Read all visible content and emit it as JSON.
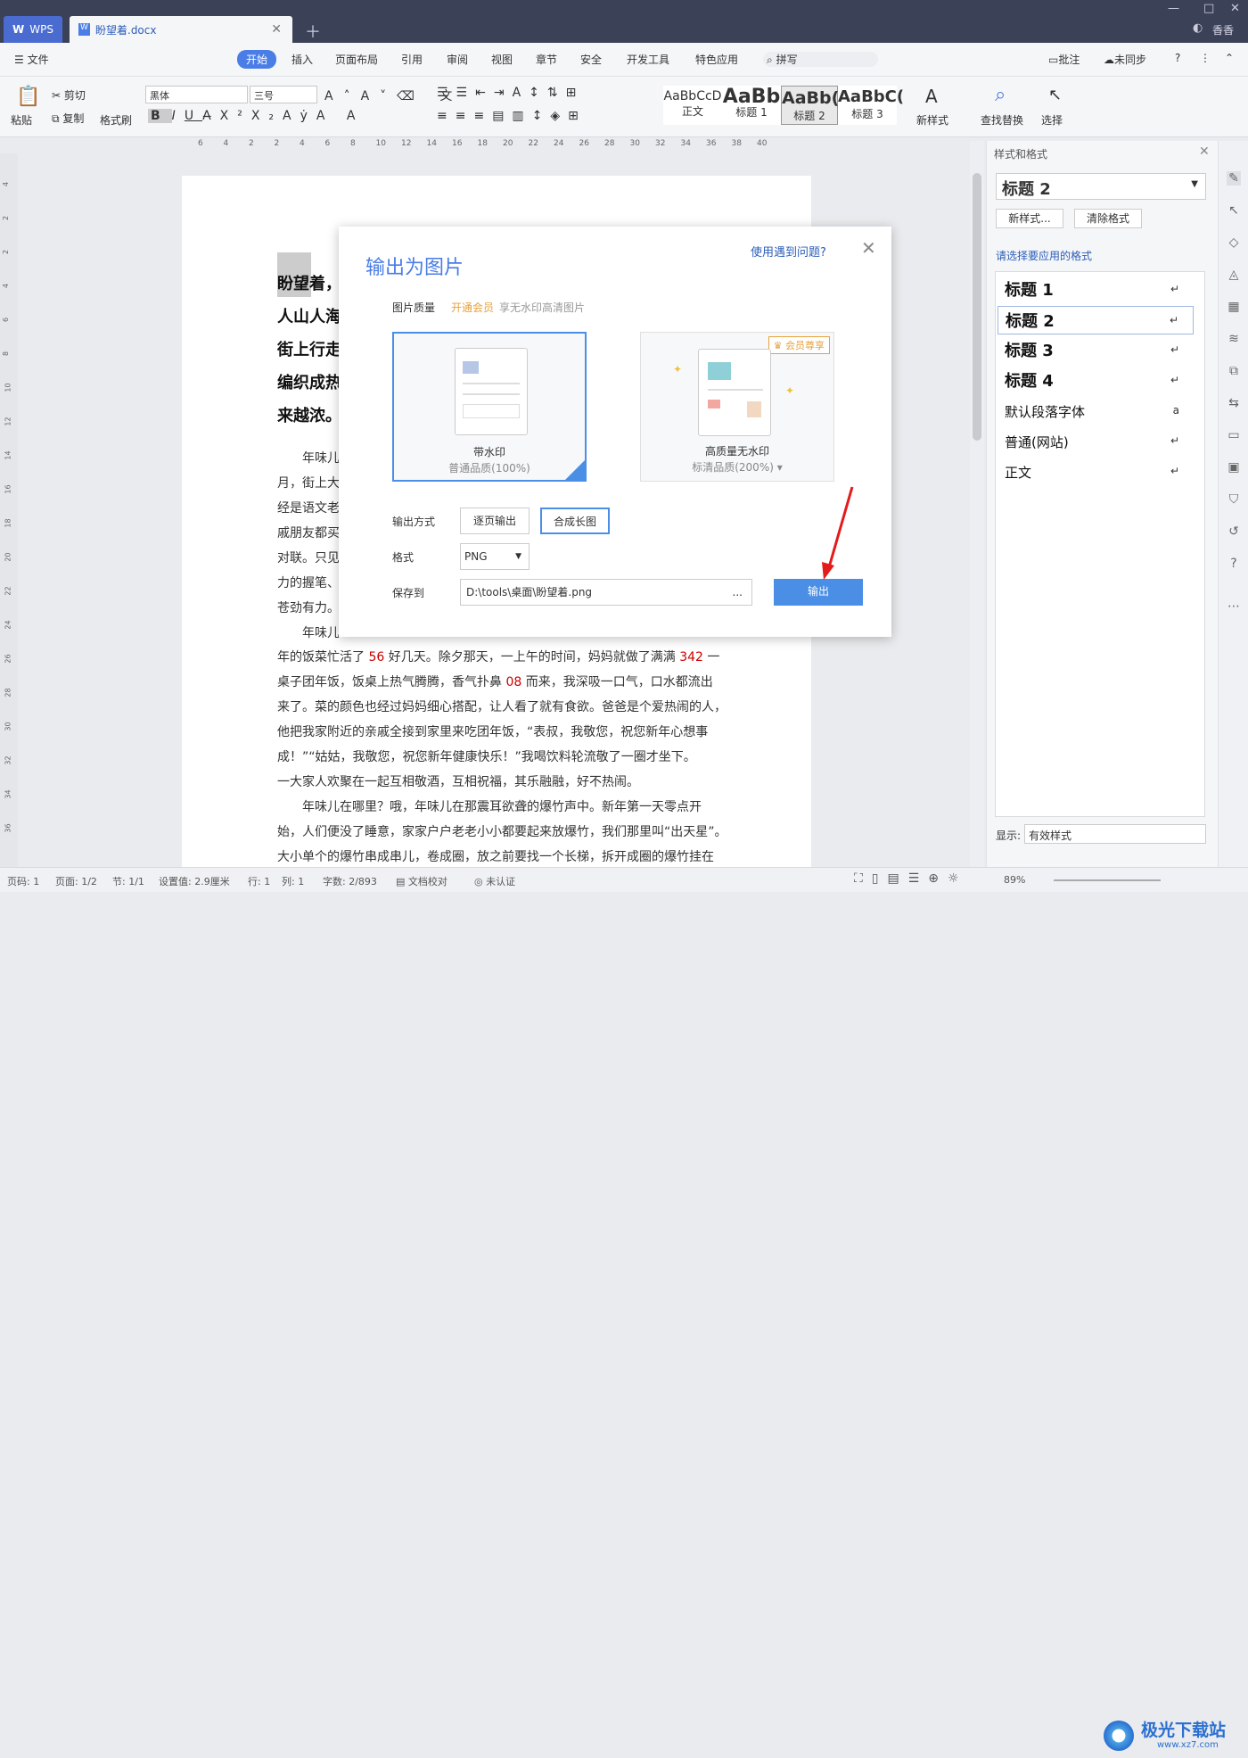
{
  "app": {
    "wps_tab": "WPS",
    "doc_tab": "盼望着.docx",
    "user": "香香"
  },
  "menu": {
    "file": "文件",
    "items": [
      "开始",
      "插入",
      "页面布局",
      "引用",
      "审阅",
      "视图",
      "章节",
      "安全",
      "开发工具",
      "特色应用"
    ],
    "search": "拼写",
    "review": "批注",
    "sync": "未同步"
  },
  "ribbon": {
    "paste": "粘贴",
    "cut": "剪切",
    "copy": "复制",
    "format_painter": "格式刷",
    "font": "黑体",
    "size": "三号",
    "styles": [
      {
        "preview": "AaBbCcD",
        "name": "正文"
      },
      {
        "preview": "AaBb",
        "name": "标题 1"
      },
      {
        "preview": "AaBb(",
        "name": "标题 2"
      },
      {
        "preview": "AaBbC(",
        "name": "标题 3"
      }
    ],
    "new_style": "新样式",
    "find_replace": "查找替换",
    "select": "选择"
  },
  "ruler": {
    "ticks": [
      "6",
      "4",
      "2",
      "2",
      "4",
      "6",
      "8",
      "10",
      "12",
      "14",
      "16",
      "18",
      "20",
      "22",
      "24",
      "26",
      "28",
      "30",
      "32",
      "34",
      "36",
      "38",
      "40"
    ],
    "vticks": [
      "4",
      "2",
      "2",
      "4",
      "6",
      "8",
      "10",
      "12",
      "14",
      "16",
      "18",
      "20",
      "22",
      "24",
      "26",
      "28",
      "30",
      "32",
      "34",
      "36"
    ]
  },
  "doc": {
    "bold_lines": [
      "盼望着，",
      "人山人海",
      "街上行走",
      "编织成热",
      "来越浓。"
    ],
    "lines": [
      "　　年味儿",
      "月，街上大",
      "经是语文老",
      "戚朋友都买",
      "对联。只见",
      "力的握笔、",
      "苍劲有力。",
      "　　年味儿"
    ],
    "full_lines": [
      [
        "年的饭菜忙活了 ",
        "56",
        " 好几天。除夕那天，一上午的时间，妈妈就做了满满 ",
        "342",
        " 一"
      ],
      [
        "桌子团年饭，饭桌上热气腾腾，香气扑鼻 ",
        "08",
        " 而来，我深吸一口气，口水都流出",
        "",
        " "
      ],
      [
        "来了。菜的颜色也经过妈妈细心搭配，让人看了就有食欲。爸爸是个爱热闹的人，",
        "",
        "",
        "",
        ""
      ],
      [
        "他把我家附近的亲戚全接到家里来吃团年饭，“表叔，我敬您，祝您新年心想事",
        "",
        "",
        "",
        ""
      ],
      [
        "成！”“姑姑，我敬您，祝您新年健康快乐！”我喝饮料轮流敬了一圈才坐下。",
        "",
        "",
        "",
        ""
      ],
      [
        "一大家人欢聚在一起互相敬酒，互相祝福，其乐融融，好不热闹。",
        "",
        "",
        "",
        ""
      ],
      [
        "　　年味儿在哪里？哦，年味儿在那震耳欲聋的爆竹声中。新年第一天零点开",
        "",
        "",
        "",
        ""
      ],
      [
        "始，人们便没了睡意，家家户户老老小小都要起来放爆竹，我们那里叫“出天星”。",
        "",
        "",
        "",
        ""
      ],
      [
        "大小单个的爆竹串成串儿，卷成圈，放之前要找一个长梯，拆开成圈的爆竹挂在",
        "",
        "",
        "",
        ""
      ]
    ]
  },
  "dialog": {
    "title": "输出为图片",
    "help": "使用遇到问题?",
    "quality_label": "图片质量",
    "vip_link": "开通会员",
    "vip_desc": "享无水印高清图片",
    "card1": {
      "name": "带水印",
      "desc": "普通品质(100%)"
    },
    "card2": {
      "badge": "会员尊享",
      "name": "高质量无水印",
      "desc": "标清品质(200%)"
    },
    "mode_label": "输出方式",
    "mode_page": "逐页输出",
    "mode_long": "合成长图",
    "format_label": "格式",
    "format": "PNG",
    "save_label": "保存到",
    "save_path": "D:\\tools\\桌面\\盼望着.png",
    "browse": "...",
    "export": "输出"
  },
  "panel": {
    "title": "样式和格式",
    "current": "标题  2",
    "new_style": "新样式...",
    "clear": "清除格式",
    "apply_label": "请选择要应用的格式",
    "styles": [
      {
        "name": "标题  1",
        "bold": true,
        "mark": "↵"
      },
      {
        "name": "标题  2",
        "bold": true,
        "mark": "↵"
      },
      {
        "name": "标题  3",
        "bold": true,
        "mark": "↵"
      },
      {
        "name": "标题  4",
        "bold": true,
        "mark": "↵"
      },
      {
        "name": "默认段落字体",
        "bold": false,
        "mark": "a"
      },
      {
        "name": "普通(网站)",
        "bold": false,
        "mark": "↵"
      },
      {
        "name": "正文",
        "bold": false,
        "mark": "↵"
      }
    ],
    "show_label": "显示:",
    "show_value": "有效样式"
  },
  "status": {
    "page": "页码: 1",
    "pages": "页面: 1/2",
    "section": "节: 1/1",
    "setting": "设置值: 2.9厘米",
    "row": "行: 1",
    "col": "列: 1",
    "words": "字数: 2/893",
    "proof": "文档校对",
    "cert": "未认证",
    "zoom": "89%",
    "watermark": "极光下载站",
    "watermark_url": "www.xz7.com"
  },
  "colors": {
    "accent": "#4a7de6",
    "titlebar": "#3b4257",
    "export": "#4a8ee6",
    "vip": "#e8a23a"
  }
}
